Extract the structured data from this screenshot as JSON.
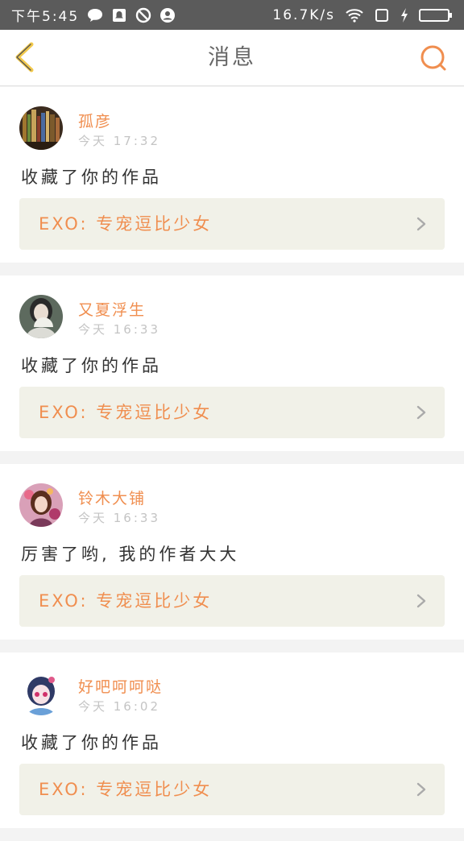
{
  "status_bar": {
    "time": "下午5:45",
    "speed": "16.7K/s",
    "icons": [
      "chat-bubble-icon",
      "notification-icon",
      "block-icon",
      "account-icon",
      "wifi-icon",
      "square-icon",
      "charging-icon",
      "battery-icon"
    ]
  },
  "header": {
    "title": "消息",
    "back_icon": "chevron-left-icon",
    "search_icon": "search-icon"
  },
  "colors": {
    "accent": "#f08e4f",
    "back_arrow": "#f2c94c",
    "card_bg": "#ffffff",
    "work_bg": "#f1f1e8"
  },
  "messages": [
    {
      "user": "孤彦",
      "time": "今天 17:32",
      "text": "收藏了你的作品",
      "work": "EXO: 专宠逗比少女"
    },
    {
      "user": "又夏浮生",
      "time": "今天 16:33",
      "text": "收藏了你的作品",
      "work": "EXO: 专宠逗比少女"
    },
    {
      "user": "铃木大铺",
      "time": "今天 16:33",
      "text": "厉害了哟, 我的作者大大",
      "work": "EXO: 专宠逗比少女"
    },
    {
      "user": "好吧呵呵哒",
      "time": "今天 16:02",
      "text": "收藏了你的作品",
      "work": "EXO: 专宠逗比少女"
    }
  ]
}
